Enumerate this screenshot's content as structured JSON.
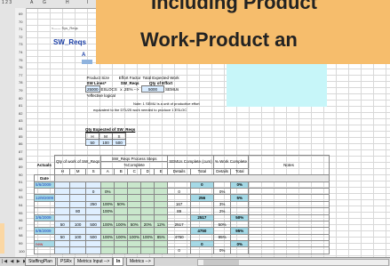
{
  "banner": {
    "line1": "Including Product",
    "line2": "Work-Product an"
  },
  "sheet": {
    "breadcrumb": "<------ Sys_Reqs",
    "title": "SW_Reqs",
    "a_mark": "A"
  },
  "headers": {
    "outline_levels": "1 2 3",
    "columns": [
      "A",
      "G",
      "H",
      "I"
    ],
    "rows": [
      "69",
      "70",
      "71",
      "72",
      "73",
      "74",
      "75",
      "76",
      "77",
      "78",
      "79",
      "80",
      "81",
      "82",
      "83",
      "84",
      "85",
      "86",
      "87",
      "88",
      "89",
      "90",
      "91",
      "92",
      "93",
      "94",
      "95",
      "96",
      "97",
      "98",
      "99",
      "100"
    ]
  },
  "size_table": {
    "product_size": "Product Size",
    "sw_lines": "SW Lines*",
    "lines_value": "25000",
    "lines_unit": "ESLOCS",
    "effective_note": "*effective logical",
    "effort_factor": "Effort Factor",
    "sw_reqs": "SW_Reqs",
    "factor_value": "x .2E% -->",
    "total_expected": "Total Expected Work",
    "qty_effort": "Qty of Effort",
    "effort_value": "5000",
    "effort_unit": "SEMUs"
  },
  "note": {
    "line1": "Note: 1 SEMU is a unit of productive effort",
    "line2": "equivalent to the DTU25 work needed to produce 1 ESLOC"
  },
  "qty_expected": {
    "title": "Qty Expected of SW_Reqs",
    "headers": [
      "H",
      "M",
      "S"
    ],
    "values": [
      "50",
      "100",
      "500"
    ]
  },
  "main_table": {
    "actuals": "Actuals",
    "date": "Date",
    "qty_work": "Qty of work of SW_Reqs",
    "hms": [
      "H",
      "M",
      "S"
    ],
    "process_steps": "SW_Reqs Process Steps",
    "pct_complete": "%Complete",
    "steps": [
      "A",
      "B",
      "C",
      "D",
      "E"
    ],
    "semu_complete": "SEMUs Complete (cum)",
    "details": "Details",
    "total": "Total",
    "work_complete": "% Work Complete",
    "notes": "Notes",
    "rows": [
      {
        "date": "5/6/2009",
        "h": "",
        "m": "",
        "s": "",
        "a": "",
        "b": "",
        "c": "",
        "d": "",
        "e": "",
        "det": "",
        "tot": "0",
        "wdet": "",
        "wtot": "0%"
      },
      {
        "date": "",
        "h": "",
        "m": "",
        "s": "0",
        "a": "0%",
        "b": "",
        "c": "",
        "d": "",
        "e": "",
        "det": "0",
        "tot": "",
        "wdet": "0%",
        "wtot": ""
      },
      {
        "date": "12/9/2009",
        "h": "",
        "m": "",
        "s": "",
        "a": "",
        "b": "",
        "c": "",
        "d": "",
        "e": "",
        "det": "",
        "tot": "256",
        "wdet": "",
        "wtot": "5%"
      },
      {
        "date": "",
        "h": "",
        "m": "",
        "s": "250",
        "a": "100%",
        "b": "50%",
        "c": "",
        "d": "",
        "e": "",
        "det": "167",
        "tot": "",
        "wdet": "3%",
        "wtot": ""
      },
      {
        "date": "",
        "h": "",
        "m": "80",
        "s": "",
        "a": "100%",
        "b": "",
        "c": "",
        "d": "",
        "e": "",
        "det": "89",
        "tot": "",
        "wdet": "2%",
        "wtot": ""
      },
      {
        "date": "3/6/2009",
        "h": "",
        "m": "",
        "s": "",
        "a": "",
        "b": "",
        "c": "",
        "d": "",
        "e": "",
        "det": "",
        "tot": "2517",
        "wdet": "",
        "wtot": "50%"
      },
      {
        "date": "",
        "h": "50",
        "m": "100",
        "s": "500",
        "a": "100%",
        "b": "100%",
        "c": "50%",
        "d": "20%",
        "e": "12%",
        "det": "2517",
        "tot": "",
        "wdet": "50%",
        "wtot": ""
      },
      {
        "date": "6/9/2009",
        "h": "",
        "m": "",
        "s": "",
        "a": "",
        "b": "",
        "c": "",
        "d": "",
        "e": "",
        "det": "",
        "tot": "4750",
        "wdet": "",
        "wtot": "95%"
      },
      {
        "date": "",
        "h": "50",
        "m": "100",
        "s": "500",
        "a": "100%",
        "b": "100%",
        "c": "100%",
        "d": "100%",
        "e": "85%",
        "det": "4750",
        "tot": "",
        "wdet": "95%",
        "wtot": ""
      },
      {
        "date": "new",
        "h": "",
        "m": "",
        "s": "",
        "a": "",
        "b": "",
        "c": "",
        "d": "",
        "e": "",
        "det": "",
        "tot": "0",
        "wdet": "",
        "wtot": "0%"
      },
      {
        "date": "",
        "h": "",
        "m": "",
        "s": "",
        "a": "",
        "b": "",
        "c": "",
        "d": "",
        "e": "",
        "det": "0",
        "tot": "",
        "wdet": "0%",
        "wtot": ""
      }
    ]
  },
  "tabs": {
    "nav": "|◀ ◀ ▶ ▶|",
    "items": [
      "StaffingPlan",
      "PSRx",
      "Metrics Input -->",
      "In",
      "Metrics -->"
    ]
  }
}
